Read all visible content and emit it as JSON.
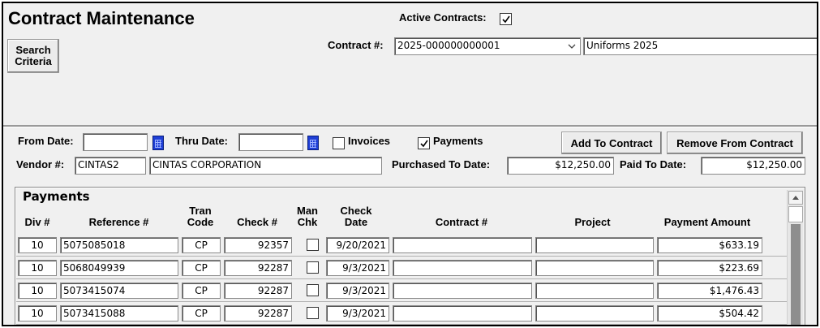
{
  "header": {
    "title": "Contract Maintenance",
    "search_button": "Search\nCriteria",
    "active_contracts_label": "Active Contracts:",
    "active_contracts_checked": true,
    "contract_label": "Contract #:",
    "contract_number": "2025-000000000001",
    "contract_description": "Uniforms 2025"
  },
  "filters": {
    "from_date_label": "From Date:",
    "from_date_value": "",
    "thru_date_label": "Thru Date:",
    "thru_date_value": "",
    "invoices_label": "Invoices",
    "invoices_checked": false,
    "payments_label": "Payments",
    "payments_checked": true,
    "add_button": "Add To Contract",
    "remove_button": "Remove From Contract",
    "vendor_label": "Vendor #:",
    "vendor_code": "CINTAS2",
    "vendor_name": "CINTAS CORPORATION",
    "purchased_label": "Purchased To Date:",
    "purchased_value": "$12,250.00",
    "paid_label": "Paid To Date:",
    "paid_value": "$12,250.00"
  },
  "payments": {
    "group_title": "Payments",
    "columns": {
      "div": "Div #",
      "reference": "Reference #",
      "tran_code": "Tran\nCode",
      "check_no": "Check #",
      "man_chk": "Man\nChk",
      "check_date": "Check\nDate",
      "contract": "Contract #",
      "project": "Project",
      "amount": "Payment Amount"
    },
    "rows": [
      {
        "div": "10",
        "reference": "5075085018",
        "tran_code": "CP",
        "check_no": "92357",
        "man_chk": false,
        "check_date": "9/20/2021",
        "contract": "",
        "project": "",
        "amount": "$633.19"
      },
      {
        "div": "10",
        "reference": "5068049939",
        "tran_code": "CP",
        "check_no": "92287",
        "man_chk": false,
        "check_date": "9/3/2021",
        "contract": "",
        "project": "",
        "amount": "$223.69"
      },
      {
        "div": "10",
        "reference": "5073415074",
        "tran_code": "CP",
        "check_no": "92287",
        "man_chk": false,
        "check_date": "9/3/2021",
        "contract": "",
        "project": "",
        "amount": "$1,476.43"
      },
      {
        "div": "10",
        "reference": "5073415088",
        "tran_code": "CP",
        "check_no": "92287",
        "man_chk": false,
        "check_date": "9/3/2021",
        "contract": "",
        "project": "",
        "amount": "$504.42"
      }
    ]
  }
}
